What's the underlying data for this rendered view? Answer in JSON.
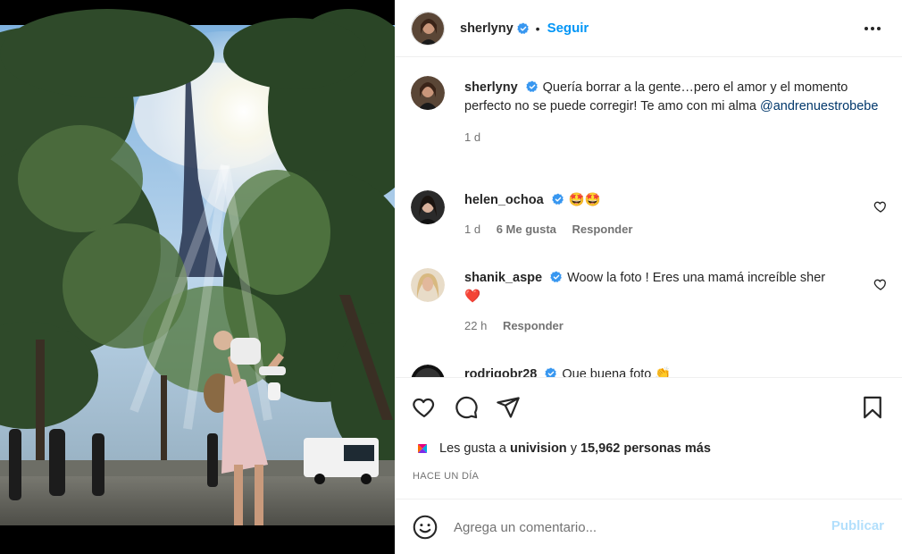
{
  "post": {
    "author": "sherlyny",
    "follow_label": "Seguir",
    "separator": "•",
    "caption": "Quería borrar a la gente…pero el amor y el momento perfecto no se puede corregir! Te amo con mi alma",
    "caption_mention": "@andrenuestrobebe",
    "caption_time": "1 d"
  },
  "comments": [
    {
      "username": "helen_ochoa",
      "text": "🤩🤩",
      "time": "1 d",
      "likes": "6 Me gusta",
      "reply": "Responder"
    },
    {
      "username": "shanik_aspe",
      "text": "Woow la foto ! Eres una mamá increíble sher",
      "text2": "❤️",
      "time": "22 h",
      "reply": "Responder"
    },
    {
      "username": "rodrigobr28",
      "text": "Que buena foto 👏"
    }
  ],
  "likes": {
    "prefix": "Les gusta a",
    "first_user": "univision",
    "middle": "y",
    "count": "15,962 personas más"
  },
  "posted": "Hace un día",
  "composer": {
    "placeholder": "Agrega un comentario...",
    "publish_label": "Publicar"
  },
  "icons": {
    "verified": "verified-badge-icon",
    "more": "more-horizontal-icon",
    "like": "heart-icon",
    "comment": "comment-bubble-icon",
    "share": "paper-plane-icon",
    "save": "bookmark-icon",
    "emoji": "emoji-smile-icon"
  },
  "colors": {
    "accent": "#0095f6",
    "verified": "#3897f0",
    "publish_disabled": "#b2dffc",
    "secondary_text": "#737373"
  }
}
